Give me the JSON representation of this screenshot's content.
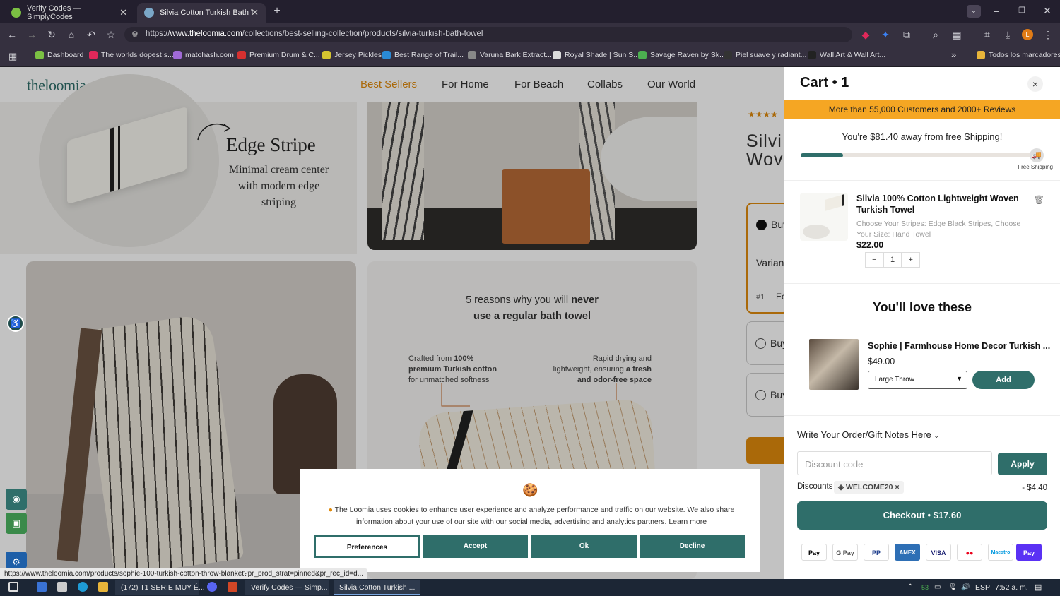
{
  "browser": {
    "tabs": [
      {
        "label": "Verify Codes — SimplyCodes",
        "active": false,
        "favicon_color": "#7bc043"
      },
      {
        "label": "Silvia Cotton Turkish Bath Towe",
        "active": true,
        "favicon_color": "#7aa7c7"
      }
    ],
    "url_prefix": "https://",
    "url_host": "www.theloomia.com",
    "url_path": "/collections/best-selling-collection/products/silvia-turkish-bath-towel",
    "profile_initial": "L",
    "bookmarks": [
      {
        "label": "Dashboard",
        "color": "#7bc043"
      },
      {
        "label": "The worlds dopest s...",
        "color": "#e0285a"
      },
      {
        "label": "matohash.com",
        "color": "#a06ad6"
      },
      {
        "label": "Premium Drum & C...",
        "color": "#d63030"
      },
      {
        "label": "Jersey Pickles",
        "color": "#d6c530"
      },
      {
        "label": "Best Range of Trail...",
        "color": "#2a8ad6"
      },
      {
        "label": "Varuna Bark Extract...",
        "color": "#888888"
      },
      {
        "label": "Royal Shade | Sun S...",
        "color": "#dddddd"
      },
      {
        "label": "Savage Raven by Sk...",
        "color": "#4caf50"
      },
      {
        "label": "Piel suave y radiant...",
        "color": "#333333"
      },
      {
        "label": "Wall Art & Wall Art...",
        "color": "#222222"
      }
    ],
    "all_bookmarks": "Todos los marcadores",
    "overflow": "»"
  },
  "site": {
    "logo": "theloomia",
    "nav": [
      "Best Sellers",
      "For Home",
      "For Beach",
      "Collabs",
      "Our World"
    ],
    "active_nav": "Best Sellers",
    "edge_stripe_title": "Edge Stripe",
    "edge_stripe_sub": "Minimal cream center with modern edge striping",
    "reasons_title_pre": "5 reasons why you will ",
    "reasons_title_bold": "never",
    "reasons_title_line2": "use a regular bath towel",
    "reason_left_pre": "Crafted from ",
    "reason_left_bold": "100% premium Turkish cotton",
    "reason_left_post": " for unmatched softness",
    "reason_right_pre": "Rapid drying and lightweight, ensuring ",
    "reason_right_bold": "a fresh and odor-free space",
    "product_title_partial": "Silvi Wov",
    "rating_stars": "★★★★",
    "option_1": "Buy",
    "variant_label": "Varian",
    "variant_index": "#1",
    "variant_value": "Ec",
    "option_2": "Buy",
    "option_3": "Buy"
  },
  "cart": {
    "title": "Cart • 1",
    "close": "×",
    "promo": "More than 55,000 Customers and 2000+ Reviews",
    "shipping_message": "You're $81.40 away from free Shipping!",
    "shipping_progress": 0.18,
    "shipping_label": "Free Shipping",
    "item": {
      "title": "Silvia 100% Cotton Lightweight Woven Turkish Towel",
      "variant": "Choose Your Stripes: Edge Black Stripes, Choose Your Size: Hand Towel",
      "price": "$22.00",
      "qty_minus": "−",
      "qty": "1",
      "qty_plus": "+"
    },
    "recommend_heading": "You'll love these",
    "recommend": {
      "title": "Sophie | Farmhouse Home Decor Turkish ...",
      "price": "$49.00",
      "option": "Large Throw",
      "add": "Add"
    },
    "notes": "Write Your Order/Gift Notes Here",
    "discount_placeholder": "Discount code",
    "apply": "Apply",
    "discounts_label": "Discounts",
    "discount_code": "WELCOME20",
    "discount_amount": "- $4.40",
    "checkout": "Checkout • $17.60",
    "payment_methods": [
      {
        "name": "Apple Pay",
        "label": "Pay",
        "color": "#000000"
      },
      {
        "name": "Google Pay",
        "label": "G Pay",
        "color": "#555555"
      },
      {
        "name": "PayPal",
        "label": "PP",
        "color": "#1a3a8a"
      },
      {
        "name": "American Express",
        "label": "AMEX",
        "color": "#2e6fb5"
      },
      {
        "name": "Visa",
        "label": "VISA",
        "color": "#1a1f71"
      },
      {
        "name": "Mastercard",
        "label": "●●",
        "color": "#eb001b"
      },
      {
        "name": "Maestro",
        "label": "Maestro",
        "color": "#0099df"
      },
      {
        "name": "Shop Pay",
        "label": "Pay",
        "color": "#5a31f4"
      }
    ]
  },
  "cookie": {
    "text": "The Loomia uses cookies to enhance user experience and analyze performance and traffic on our website. We also share information about your use of our site with our social media, advertising and analytics partners.",
    "learn_more": "Learn more",
    "buttons": [
      "Preferences",
      "Accept",
      "Ok",
      "Decline"
    ]
  },
  "status_url": "https://www.theloomia.com/products/sophie-100-turkish-cotton-throw-blanket?pr_prod_strat=pinned&pr_rec_id=d...",
  "taskbar": {
    "items": [
      "(172) T1 SERIE MUY É...",
      "Verify Codes — Simp...",
      "Silvia Cotton Turkish ..."
    ],
    "language": "ESP",
    "time": "7:52 a. m.",
    "badge": "53"
  }
}
